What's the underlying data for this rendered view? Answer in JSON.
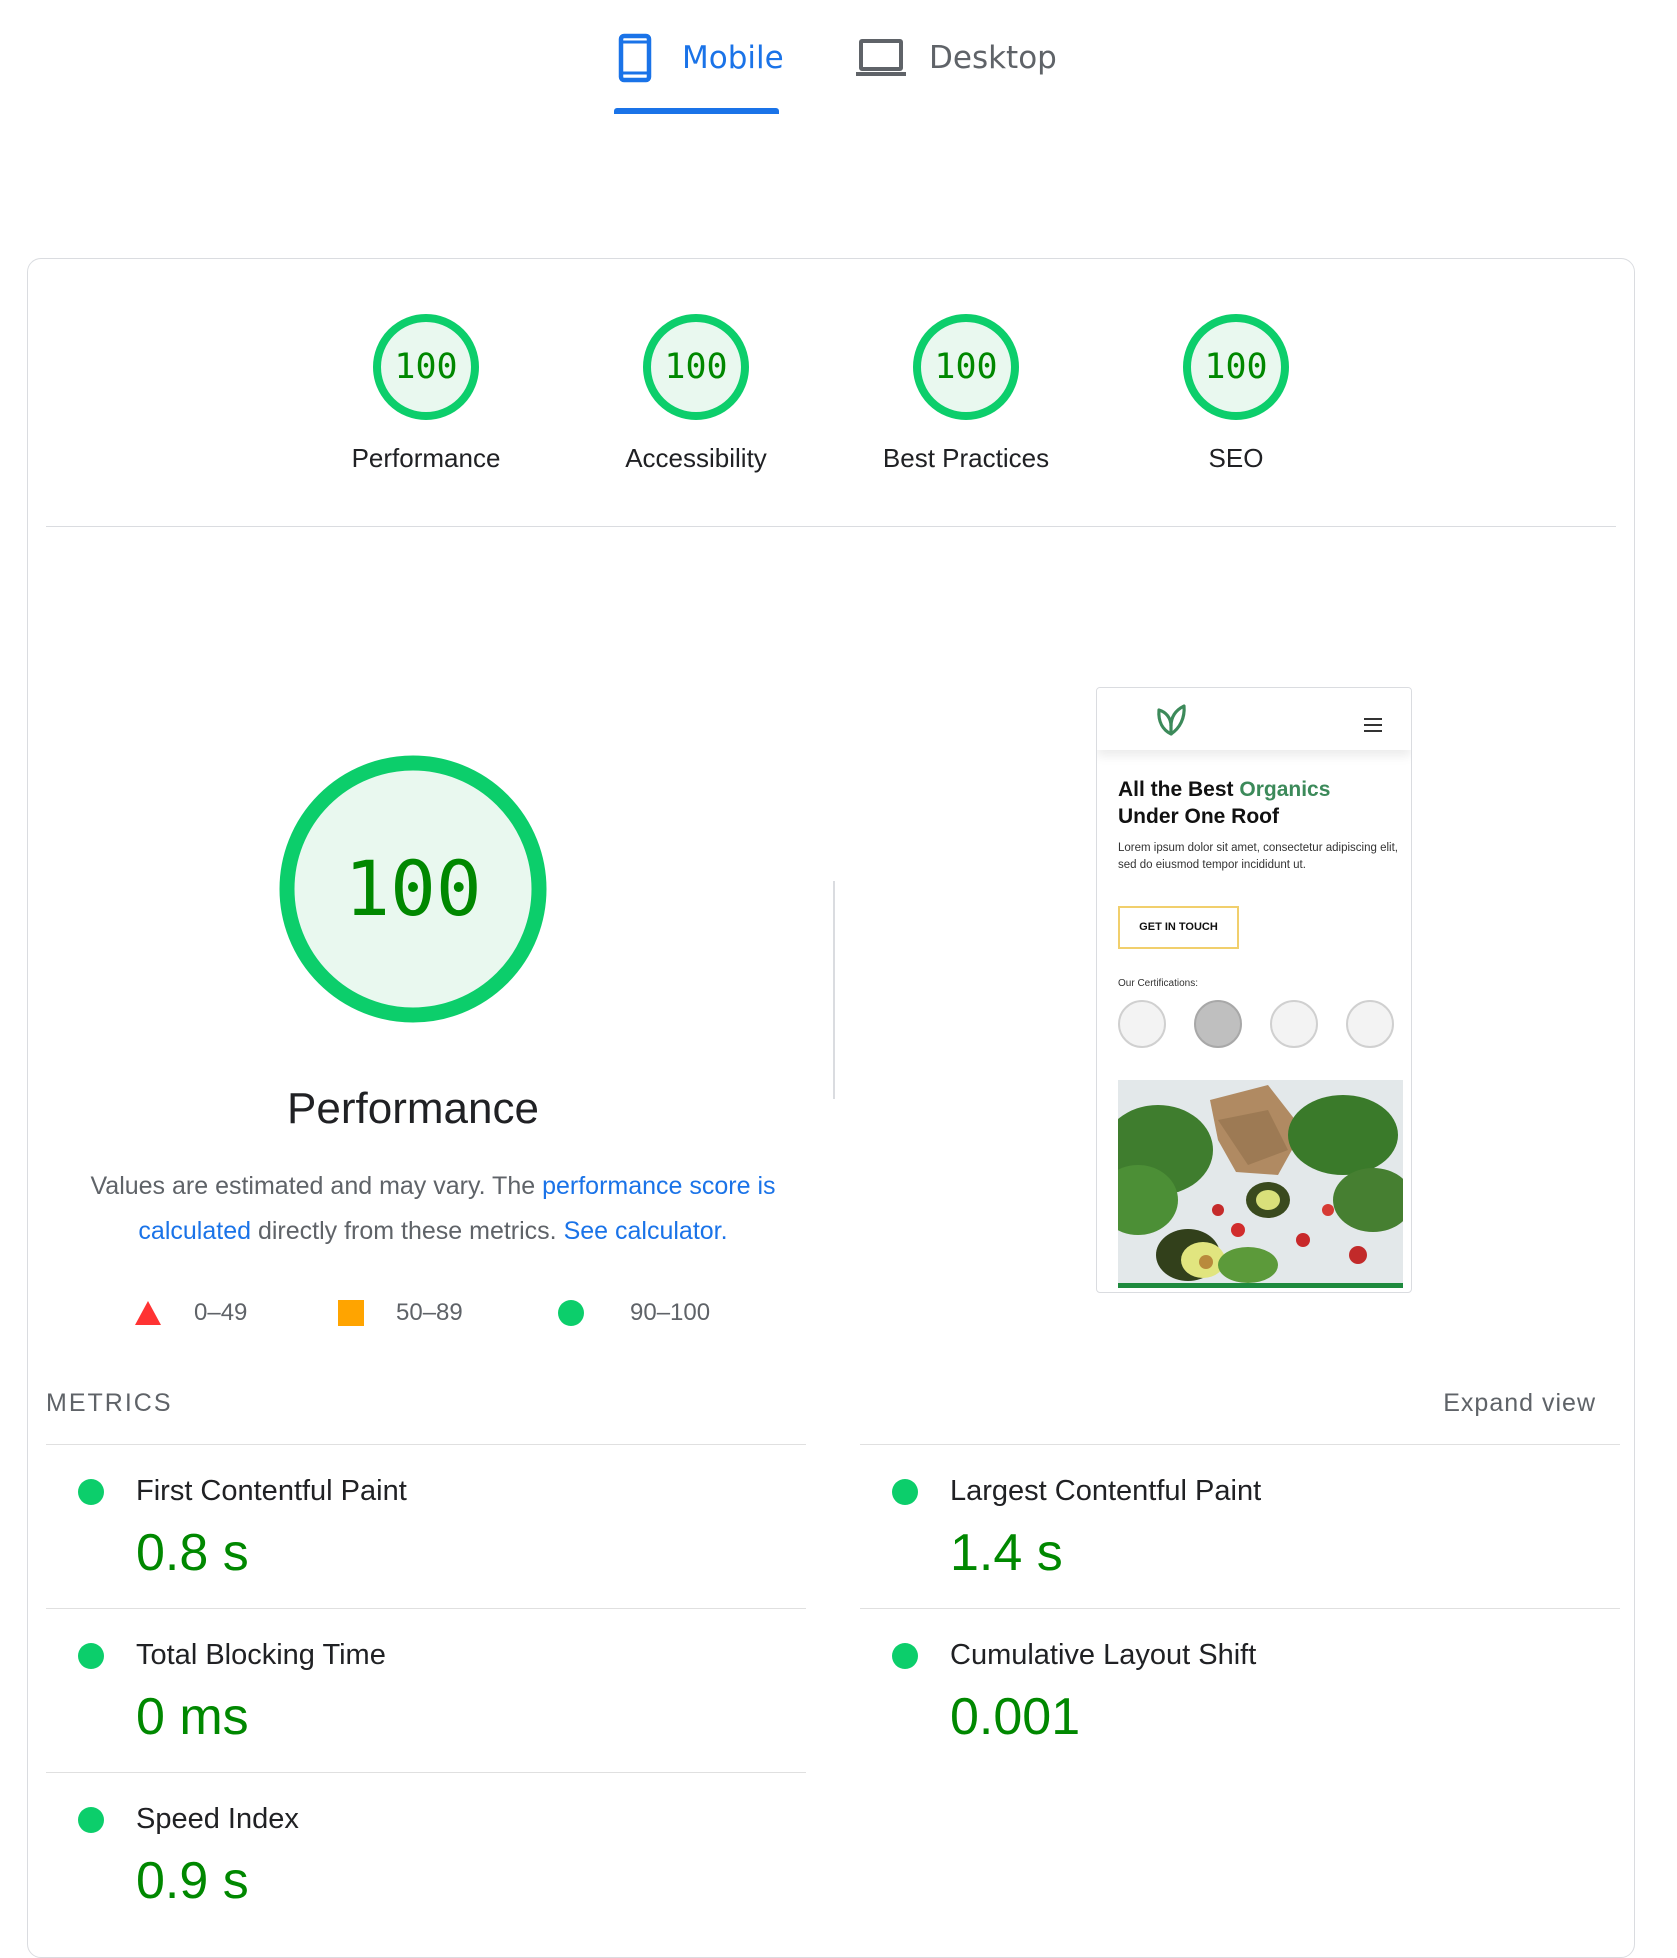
{
  "tabs": {
    "mobile_label": "Mobile",
    "desktop_label": "Desktop",
    "active": "Mobile"
  },
  "categories": [
    {
      "score": "100",
      "label": "Performance"
    },
    {
      "score": "100",
      "label": "Accessibility"
    },
    {
      "score": "100",
      "label": "Best Practices"
    },
    {
      "score": "100",
      "label": "SEO"
    }
  ],
  "performance": {
    "score": "100",
    "title": "Performance",
    "desc_prefix": "Values are estimated and may vary. The ",
    "desc_link1": "performance score is calculated",
    "desc_middle": " directly from these metrics. ",
    "desc_link2": "See calculator."
  },
  "legend": {
    "fail": "0–49",
    "average": "50–89",
    "pass": "90–100"
  },
  "preview": {
    "title_part1": "All the Best ",
    "title_green": "Organics",
    "title_part2": "Under One Roof",
    "body": "Lorem ipsum dolor sit amet, consectetur adipiscing elit, sed do eiusmod tempor incididunt ut.",
    "button": "GET IN TOUCH",
    "certifications_label": "Our Certifications:"
  },
  "metrics_section": {
    "label": "METRICS",
    "expand": "Expand view"
  },
  "metrics": {
    "fcp": {
      "label": "First Contentful Paint",
      "value": "0.8 s"
    },
    "lcp": {
      "label": "Largest Contentful Paint",
      "value": "1.4 s"
    },
    "tbt": {
      "label": "Total Blocking Time",
      "value": "0 ms"
    },
    "cls": {
      "label": "Cumulative Layout Shift",
      "value": "0.001"
    },
    "si": {
      "label": "Speed Index",
      "value": "0.9 s"
    }
  },
  "colors": {
    "accent": "#1a73e8",
    "pass": "#0cce6b",
    "pass_text": "#008800",
    "average": "#ffa400",
    "fail": "#ff4e42"
  }
}
